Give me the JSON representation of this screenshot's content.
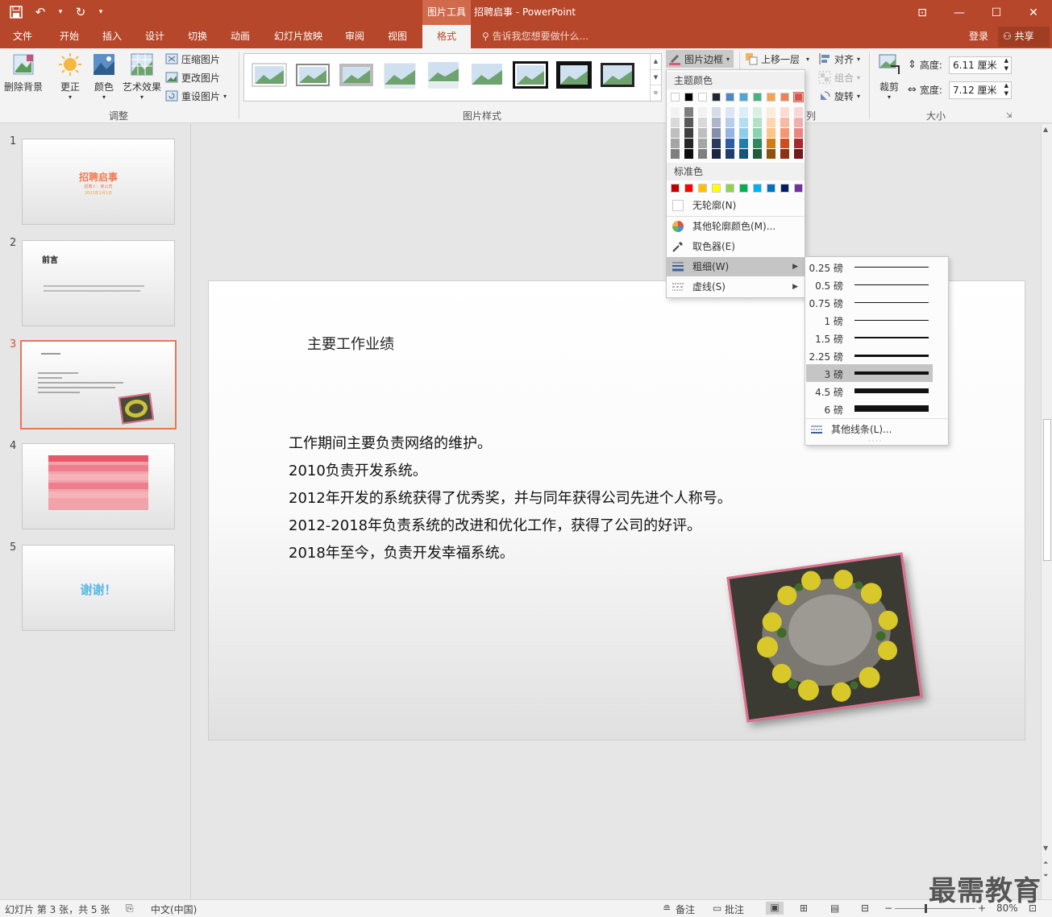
{
  "title": {
    "context_tab": "图片工具",
    "document": "招聘启事 - PowerPoint"
  },
  "tabs": [
    "文件",
    "开始",
    "插入",
    "设计",
    "切换",
    "动画",
    "幻灯片放映",
    "审阅",
    "视图",
    "格式"
  ],
  "tell_me": "告诉我您想要做什么...",
  "account": {
    "login": "登录",
    "share": "共享"
  },
  "ribbon": {
    "adjust": {
      "remove_bg": "删除背景",
      "corrections": "更正",
      "color": "颜色",
      "artistic": "艺术效果",
      "compress": "压缩图片",
      "change": "更改图片",
      "reset": "重设图片",
      "label": "调整"
    },
    "styles": {
      "label": "图片样式",
      "border": "图片边框"
    },
    "arrange": {
      "bring_forward": "上移一层",
      "align": "对齐",
      "group": "组合",
      "rotate": "旋转",
      "label_tail": "列"
    },
    "size": {
      "crop": "裁剪",
      "height_label": "高度:",
      "height": "6.11 厘米",
      "width_label": "宽度:",
      "width": "7.12 厘米",
      "label": "大小"
    }
  },
  "border_menu": {
    "theme_colors": "主题颜色",
    "standard_colors": "标准色",
    "no_outline": "无轮廓(N)",
    "more_colors": "其他轮廓颜色(M)...",
    "eyedropper": "取色器(E)",
    "weight": "粗细(W)",
    "dashes": "虚线(S)",
    "theme_top": [
      "#ffffff",
      "#000000",
      "#ffffff",
      "#1f2532",
      "#4f86c6",
      "#4aa8d8",
      "#45b57f",
      "#f4a44a",
      "#ef8058",
      "#d9534f"
    ],
    "theme_shades": [
      [
        "#f2f2f2",
        "#7f7f7f",
        "#f2f2f2",
        "#d6dbe6",
        "#dbe6f5",
        "#d9eef8",
        "#d8f0e4",
        "#fdecd7",
        "#fcdcd1",
        "#f7d7d6"
      ],
      [
        "#d9d9d9",
        "#595959",
        "#d9d9d9",
        "#aeb6cc",
        "#b8cdeb",
        "#b3def1",
        "#b1e1c9",
        "#fbd8b0",
        "#f9baa3",
        "#efafad"
      ],
      [
        "#bfbfbf",
        "#3f3f3f",
        "#bfbfbf",
        "#858fab",
        "#94b4e1",
        "#8ecdea",
        "#8ad3ae",
        "#f9c589",
        "#f59775",
        "#e78784"
      ],
      [
        "#a5a5a5",
        "#262626",
        "#a5a5a5",
        "#2a3a5e",
        "#2a5ea1",
        "#1f7fab",
        "#2e8a5c",
        "#d17c12",
        "#d24a1d",
        "#a9262d"
      ],
      [
        "#7f7f7f",
        "#0d0d0d",
        "#7f7f7f",
        "#1c2640",
        "#1c3f6b",
        "#15557a",
        "#1f5c3d",
        "#8c530c",
        "#8c3113",
        "#711a1e"
      ]
    ],
    "standard": [
      "#c00000",
      "#ff0000",
      "#ffc000",
      "#ffff00",
      "#92d050",
      "#00b050",
      "#00b0f0",
      "#0070c0",
      "#002060",
      "#7030a0"
    ]
  },
  "weight_menu": {
    "items": [
      {
        "label": "0.25 磅",
        "thickness": 0.25
      },
      {
        "label": "0.5 磅",
        "thickness": 0.5
      },
      {
        "label": "0.75 磅",
        "thickness": 0.75
      },
      {
        "label": "1 磅",
        "thickness": 1
      },
      {
        "label": "1.5 磅",
        "thickness": 1.5
      },
      {
        "label": "2.25 磅",
        "thickness": 2.25
      },
      {
        "label": "3 磅",
        "thickness": 3,
        "selected": true
      },
      {
        "label": "4.5 磅",
        "thickness": 4.5
      },
      {
        "label": "6 磅",
        "thickness": 6
      }
    ],
    "more_lines": "其他线条(L)..."
  },
  "slides": {
    "numbers": [
      "1",
      "2",
      "3",
      "4",
      "5"
    ],
    "s1": {
      "title": "招聘启事",
      "sub1": "招聘人：某公司",
      "sub2": "2021年1月1日"
    },
    "s2": {
      "title": "前言"
    },
    "s5": {
      "title": "谢谢！"
    }
  },
  "current_slide": {
    "title": "主要工作业绩",
    "body": [
      "工作期间主要负责网络的维护。",
      "2010负责开发系统。",
      "2012年开发的系统获得了优秀奖，并与同年获得公司先进个人称号。",
      "2012-2018年负责系统的改进和优化工作，获得了公司的好评。",
      "2018年至今，负责开发幸福系统。"
    ]
  },
  "status": {
    "slide_info": "幻灯片 第 3 张，共 5 张",
    "language": "中文(中国)",
    "notes": "备注",
    "comments": "批注",
    "zoom": "80%"
  },
  "watermark": "最需教育",
  "colors": {
    "accent": "#b7472a",
    "selected_thumb": "#e07a57"
  }
}
